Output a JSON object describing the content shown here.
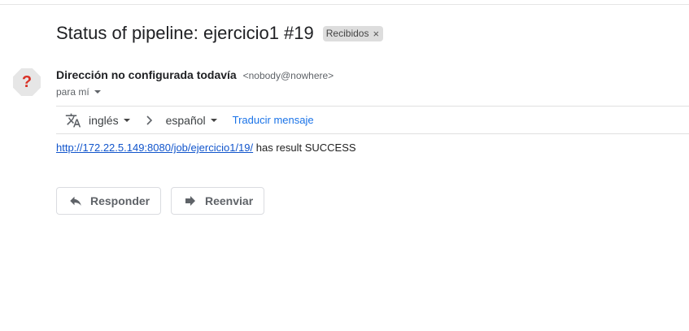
{
  "email": {
    "subject": "Status of pipeline: ejercicio1 #19",
    "label": {
      "name": "Recibidos",
      "remove_glyph": "×"
    },
    "sender": {
      "avatar_glyph": "?",
      "name": "Dirección no configurada todavía",
      "address": "<nobody@nowhere>"
    },
    "recipient_text": "para mí",
    "translation": {
      "icon": "translate-icon",
      "from_lang": "inglés",
      "to_lang": "español",
      "translate_link": "Traducir mensaje"
    },
    "body": {
      "link_text": "http://172.22.5.149:8080/job/ejercicio1/19/",
      "trailing_text": " has result SUCCESS"
    },
    "actions": {
      "reply_label": "Responder",
      "forward_label": "Reenviar"
    }
  },
  "colors": {
    "link": "#1155cc",
    "translate_link": "#1a73e8",
    "avatar_glyph": "#d93025",
    "label_chip_bg": "#dddddd"
  }
}
